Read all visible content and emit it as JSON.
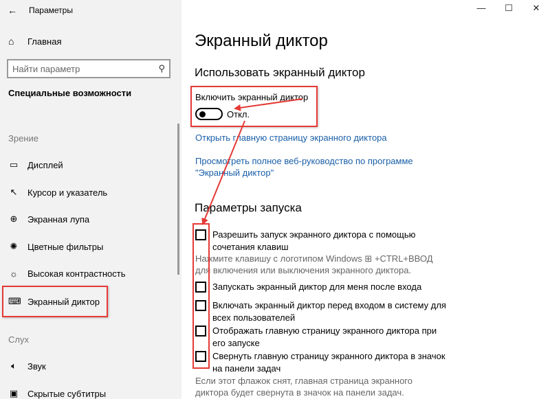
{
  "app": {
    "title": "Параметры"
  },
  "window_controls": {
    "minimize": "—",
    "maximize": "☐",
    "close": "✕"
  },
  "sidebar": {
    "home": "Главная",
    "search_placeholder": "Найти параметр",
    "section": "Специальные возможности",
    "groups": [
      {
        "label": "Зрение"
      },
      {
        "label": "Слух"
      }
    ],
    "items": [
      {
        "label": "Дисплей",
        "icon": "display-icon"
      },
      {
        "label": "Курсор и указатель",
        "icon": "cursor-icon"
      },
      {
        "label": "Экранная лупа",
        "icon": "magnifier-icon"
      },
      {
        "label": "Цветные фильтры",
        "icon": "color-filter-icon"
      },
      {
        "label": "Высокая контрастность",
        "icon": "contrast-icon"
      },
      {
        "label": "Экранный диктор",
        "icon": "narrator-icon"
      },
      {
        "label": "Звук",
        "icon": "speaker-icon"
      },
      {
        "label": "Скрытые субтитры",
        "icon": "captions-icon"
      }
    ]
  },
  "main": {
    "title": "Экранный диктор",
    "use_heading": "Использовать экранный диктор",
    "toggle_label": "Включить экранный диктор",
    "toggle_state": "Откл.",
    "link_home": "Открыть главную страницу экранного диктора",
    "link_guide_1": "Просмотреть полное веб-руководство по программе",
    "link_guide_2": "\"Экранный диктор\"",
    "startup_heading": "Параметры запуска",
    "options": [
      {
        "text": "Разрешить запуск экранного диктора с помощью сочетания клавиш",
        "checked": false
      },
      {
        "text": "Запускать экранный диктор для меня после входа",
        "checked": false
      },
      {
        "text": "Включать экранный диктор перед входом в систему для всех пользователей",
        "checked": false
      },
      {
        "text": "Отображать главную страницу экранного диктора при его запуске",
        "checked": false
      },
      {
        "text": "Свернуть главную страницу экранного диктора в значок на панели задач",
        "checked": false
      }
    ],
    "shortcut_hint": "Нажмите клавишу с логотипом Windows ⊞ +CTRL+ВВОД для включения или выключения экранного диктора.",
    "minimize_hint": "Если этот флажок снят, главная страница экранного диктора будет свернута в значок на панели задач."
  },
  "annotation_color": "#e53935"
}
